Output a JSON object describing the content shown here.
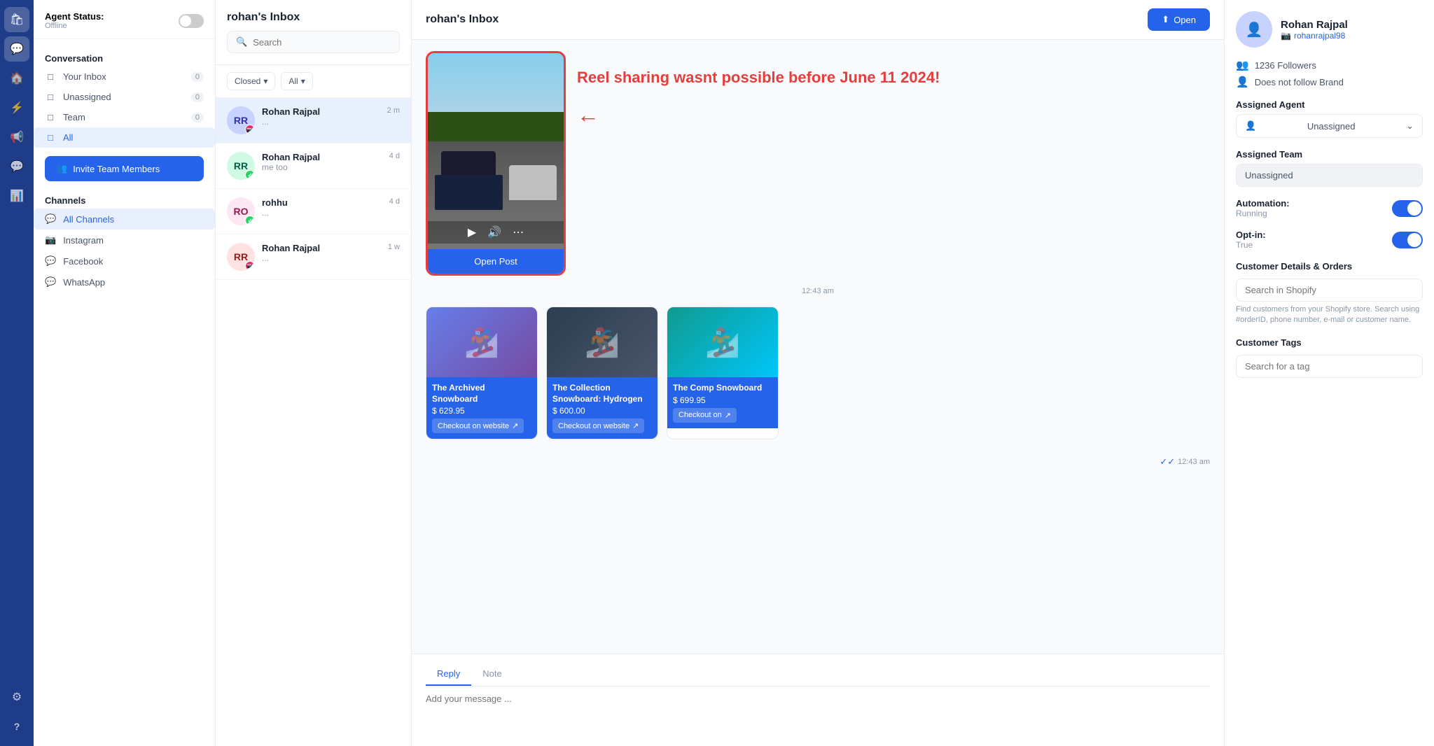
{
  "iconNav": {
    "icons": [
      {
        "name": "logo-icon",
        "symbol": "🛍",
        "active": false
      },
      {
        "name": "chat-icon",
        "symbol": "💬",
        "active": true
      },
      {
        "name": "home-icon",
        "symbol": "🏠",
        "active": false
      },
      {
        "name": "lightning-icon",
        "symbol": "⚡",
        "active": false
      },
      {
        "name": "megaphone-icon",
        "symbol": "📣",
        "active": false
      },
      {
        "name": "contacts-icon",
        "symbol": "👥",
        "active": false
      },
      {
        "name": "reports-icon",
        "symbol": "📊",
        "active": false
      },
      {
        "name": "settings-icon",
        "symbol": "⚙",
        "active": false
      },
      {
        "name": "help-icon",
        "symbol": "?",
        "active": false
      }
    ]
  },
  "sidebar": {
    "agentStatus": {
      "label": "Agent Status:",
      "sublabel": "Offline",
      "toggleOn": false
    },
    "conversationSection": "Conversation",
    "navItems": [
      {
        "label": "Your Inbox",
        "badge": "0",
        "active": false,
        "icon": "inbox"
      },
      {
        "label": "Unassigned",
        "badge": "0",
        "active": false,
        "icon": "unassigned"
      },
      {
        "label": "Team",
        "badge": "0",
        "active": false,
        "icon": "team"
      },
      {
        "label": "All",
        "badge": "",
        "active": true,
        "icon": "all"
      }
    ],
    "inviteBtn": "Invite Team Members",
    "channelsSection": "Channels",
    "channels": [
      {
        "label": "All Channels",
        "active": true,
        "platform": "all"
      },
      {
        "label": "Instagram",
        "active": false,
        "platform": "instagram"
      },
      {
        "label": "Facebook",
        "active": false,
        "platform": "facebook"
      },
      {
        "label": "WhatsApp",
        "active": false,
        "platform": "whatsapp"
      }
    ]
  },
  "convList": {
    "title": "rohan's Inbox",
    "searchPlaceholder": "Search",
    "filters": {
      "status": "Closed",
      "assigned": "All"
    },
    "conversations": [
      {
        "name": "Rohan Rajpal",
        "preview": "...",
        "time": "2 m",
        "platform": "instagram",
        "active": true,
        "initials": "RR"
      },
      {
        "name": "Rohan Rajpal",
        "preview": "me too",
        "time": "4 d",
        "platform": "whatsapp",
        "active": false,
        "initials": "RR"
      },
      {
        "name": "rohhu",
        "preview": "...",
        "time": "4 d",
        "platform": "whatsapp",
        "active": false,
        "initials": "RO"
      },
      {
        "name": "Rohan Rajpal",
        "preview": "...",
        "time": "1 w",
        "platform": "instagram",
        "active": false,
        "initials": "RR"
      }
    ]
  },
  "chat": {
    "title": "rohan's Inbox",
    "openBtn": "Open",
    "annotation": {
      "text": "Reel sharing wasnt possible before June 11 2024!"
    },
    "reel": {
      "openPostBtn": "Open Post",
      "timestamp": "12:43 am"
    },
    "products": [
      {
        "title": "The Archived Snowboard",
        "price": "$ 629.95",
        "checkoutLabel": "Checkout on website",
        "colorClass": "purple"
      },
      {
        "title": "The Collection Snowboard: Hydrogen",
        "price": "$ 600.00",
        "checkoutLabel": "Checkout on website",
        "colorClass": "dark"
      },
      {
        "title": "The Comp Snowboard",
        "price": "$ 699.95",
        "checkoutLabel": "Checkout on",
        "colorClass": "teal"
      }
    ],
    "timestamp2": "12:43 am",
    "reply": {
      "tabs": [
        "Reply",
        "Note"
      ],
      "activeTab": "Reply",
      "placeholder": "Add your message ..."
    }
  },
  "rightPanel": {
    "contact": {
      "name": "Rohan Rajpal",
      "handle": "rohanrajpal98",
      "initials": "RR",
      "followers": "1236 Followers",
      "followsBack": "Does not follow Brand"
    },
    "assignedAgent": {
      "label": "Assigned Agent",
      "value": "Unassigned"
    },
    "assignedTeam": {
      "label": "Assigned Team",
      "value": "Unassigned"
    },
    "automation": {
      "label": "Automation:",
      "status": "Running",
      "on": true
    },
    "optIn": {
      "label": "Opt-in:",
      "status": "True",
      "on": true
    },
    "customerDetails": {
      "label": "Customer Details & Orders",
      "searchPlaceholder": "Search in Shopify",
      "hint": "Find customers from your Shopify store. Search using #orderID, phone number, e-mail or customer name."
    },
    "customerTags": {
      "label": "Customer Tags",
      "searchPlaceholder": "Search for a tag"
    }
  }
}
